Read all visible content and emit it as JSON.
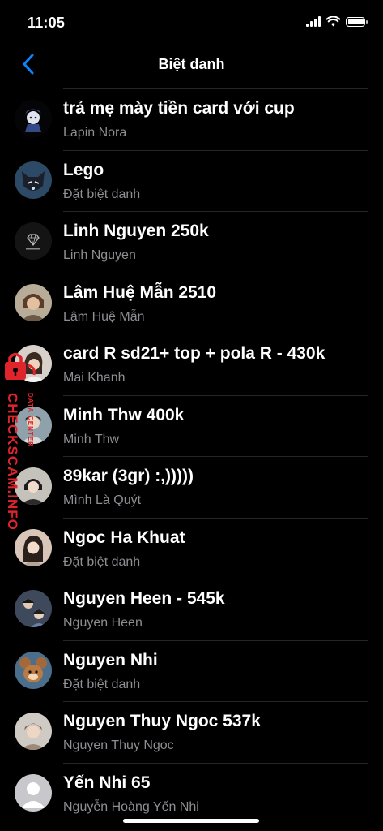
{
  "status_bar": {
    "time": "11:05"
  },
  "nav": {
    "title": "Biệt danh"
  },
  "watermark": {
    "main": "CHECKSCAM.INFO",
    "sub": "DATA CENTER"
  },
  "colors": {
    "accent": "#0a84ff",
    "secondary_text": "#8e8e93",
    "watermark": "#e0242b"
  },
  "contacts": [
    {
      "nickname": "trả mẹ mày tiền card với cup",
      "name": "Lapin Nora",
      "avatar": "anime-character-avatar"
    },
    {
      "nickname": "Lego",
      "name": "Đặt biệt danh",
      "avatar": "cat-avatar"
    },
    {
      "nickname": "Linh Nguyen 250k",
      "name": "Linh Nguyen",
      "avatar": "diamond-logo-avatar"
    },
    {
      "nickname": "Lâm Huệ Mẫn 2510",
      "name": "Lâm Huệ Mẫn",
      "avatar": "person-photo-avatar"
    },
    {
      "nickname": "card R sd21+ top + pola R - 430k",
      "name": "Mai Khanh",
      "avatar": "person-photo-avatar"
    },
    {
      "nickname": "Minh Thw 400k",
      "name": "Minh Thw",
      "avatar": "person-photo-avatar"
    },
    {
      "nickname": "89kar (3gr) :,)))))",
      "name": "Mình Là Quýt",
      "avatar": "person-photo-avatar"
    },
    {
      "nickname": "Ngoc Ha Khuat",
      "name": "Đặt biệt danh",
      "avatar": "person-photo-avatar"
    },
    {
      "nickname": "Nguyen Heen - 545k",
      "name": "Nguyen Heen",
      "avatar": "person-photo-avatar"
    },
    {
      "nickname": "Nguyen Nhi",
      "name": "Đặt biệt danh",
      "avatar": "cartoon-mouse-avatar"
    },
    {
      "nickname": "Nguyen Thuy Ngoc 537k",
      "name": "Nguyen Thuy Ngoc",
      "avatar": "person-photo-avatar"
    },
    {
      "nickname": "Yến Nhi 65",
      "name": "Nguyễn Hoàng Yến Nhi",
      "avatar": "default-user-avatar"
    }
  ]
}
